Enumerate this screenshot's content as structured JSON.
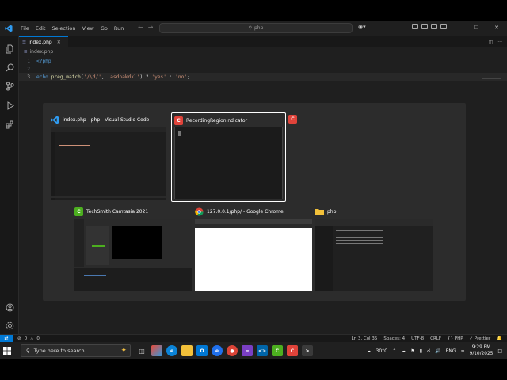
{
  "menu": [
    "File",
    "Edit",
    "Selection",
    "View",
    "Go",
    "Run",
    "···"
  ],
  "command_center": "php",
  "tab": {
    "label": "index.php",
    "close": "✕"
  },
  "breadcrumb": "index.php",
  "code": {
    "line_numbers": [
      "1",
      "2",
      "3"
    ],
    "line1": "<?php",
    "line3": {
      "echo": "echo",
      "fn": "preg_match",
      "open": "(",
      "arg1": "'/\\d/'",
      "comma": ", ",
      "arg2": "'asdnakdkl'",
      "close": ") ? ",
      "yes": "'yes'",
      "colon": " : ",
      "no": "'no'",
      "end": ";"
    }
  },
  "switcher": {
    "windows": [
      {
        "title": "index.php - php - Visual Studio Code",
        "icon": "vscode-icon",
        "color": "#0065a9"
      },
      {
        "title": "RecordingRegionIndicator",
        "icon": "camtasia-recorder-icon",
        "color": "#e0433a",
        "selected": true
      },
      {
        "title": "TechSmith Camtasia 2021",
        "icon": "camtasia-icon",
        "color": "#4caf1f"
      },
      {
        "title": "127.0.0.1/php/ - Google Chrome",
        "icon": "chrome-icon",
        "color": "#4285f4"
      },
      {
        "title": "php",
        "icon": "folder-icon",
        "color": "#f3c13a"
      }
    ]
  },
  "status": {
    "errors": "0",
    "warnings": "0",
    "position": "Ln 3, Col 35",
    "spaces": "Spaces: 4",
    "encoding": "UTF-8",
    "eol": "CRLF",
    "language": "PHP",
    "formatter": "✓ Prettier"
  },
  "taskbar": {
    "search_placeholder": "Type here to search",
    "weather": "30°C",
    "language": "ENG",
    "time": "9:29 PM",
    "date": "9/10/2025"
  }
}
